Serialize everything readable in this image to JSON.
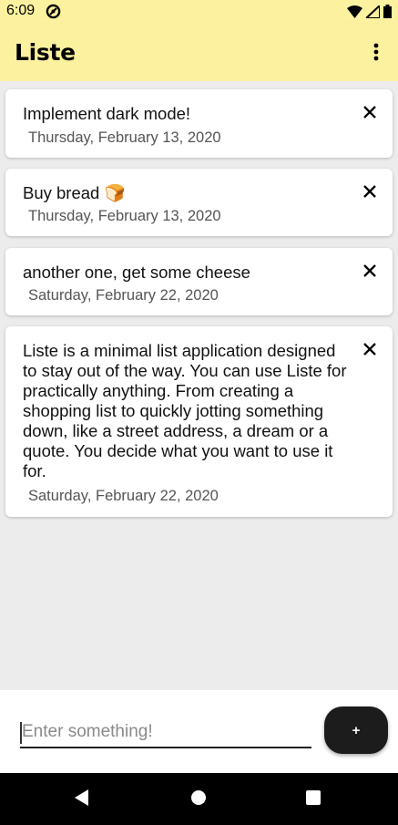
{
  "status_bar": {
    "time": "6:09"
  },
  "app_bar": {
    "title": "Liste"
  },
  "notes": [
    {
      "text": "Implement dark mode!",
      "date": "Thursday, February 13, 2020"
    },
    {
      "text": "Buy bread 🍞",
      "date": "Thursday, February 13, 2020"
    },
    {
      "text": "another one, get some cheese",
      "date": "Saturday, February 22, 2020"
    },
    {
      "text": "Liste is a minimal list application designed to stay out of the way. You can use Liste for practically anything. From creating a shopping list to quickly jotting something down, like a street address, a dream or a quote. You decide what you want to use it for.",
      "date": "Saturday, February 22, 2020"
    }
  ],
  "composer": {
    "placeholder": "Enter something!",
    "add_label": "+"
  },
  "colors": {
    "app_bar": "#fbf19f",
    "list_background": "#ececec",
    "add_button": "#1c1c1c"
  },
  "icons": {
    "overflow": "more-vert-icon",
    "close": "close-icon",
    "nav_back": "back-triangle-icon",
    "nav_home": "home-circle-icon",
    "nav_recents": "recents-square-icon"
  }
}
